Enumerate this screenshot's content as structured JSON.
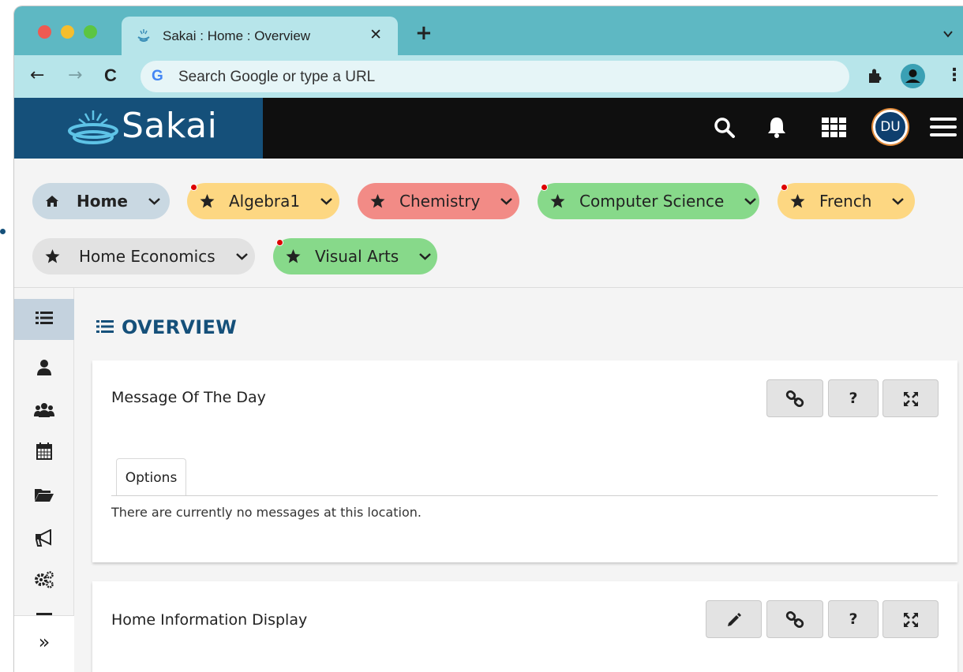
{
  "browser": {
    "tab_title": "Sakai : Home : Overview",
    "close_glyph": "✕",
    "new_tab_glyph": "+",
    "back_glyph": "←",
    "forward_glyph": "→",
    "reload_glyph": "C",
    "omnibox_g": "G",
    "omnibox_placeholder": "Search Google or type a URL",
    "menu_glyph": "⋮"
  },
  "header": {
    "logo_text": "Sakai",
    "avatar_initials": "DU"
  },
  "sites": [
    {
      "label": "Home",
      "icon": "home-icon",
      "color": "#c9d8e2",
      "alert": false
    },
    {
      "label": "Algebra1",
      "icon": "star-icon",
      "color": "#fdd782",
      "alert": true
    },
    {
      "label": "Chemistry",
      "icon": "star-icon",
      "color": "#f28b86",
      "alert": false
    },
    {
      "label": "Computer Science",
      "icon": "star-icon",
      "color": "#87d98a",
      "alert": true
    },
    {
      "label": "French",
      "icon": "star-icon",
      "color": "#fdd782",
      "alert": true
    },
    {
      "label": "Home Economics",
      "icon": "star-icon",
      "color": "#e2e2e2",
      "alert": false
    },
    {
      "label": "Visual Arts",
      "icon": "star-icon",
      "color": "#87d98a",
      "alert": true
    }
  ],
  "tools": [
    "overview-icon",
    "user-icon",
    "users-icon",
    "calendar-icon",
    "folder-open-icon",
    "bullhorn-icon",
    "cogs-icon",
    "more-icon"
  ],
  "collapse_glyph": "»",
  "page": {
    "title": "OVERVIEW"
  },
  "cards": [
    {
      "title": "Message Of The Day",
      "tab_label": "Options",
      "empty_message": "There are currently no messages at this location.",
      "buttons": [
        "link-icon",
        "help",
        "expand-icon"
      ]
    },
    {
      "title": "Home Information Display",
      "buttons": [
        "edit-icon",
        "link-icon",
        "help",
        "expand-icon"
      ]
    }
  ],
  "help_glyph": "?",
  "colors": {
    "brand_blue": "#15507a",
    "chrome_teal": "#5eb8c3",
    "chrome_light": "#b7e5ea"
  }
}
